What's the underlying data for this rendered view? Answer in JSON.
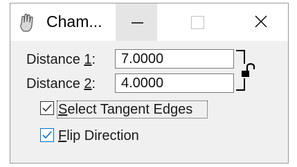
{
  "window": {
    "title": "Cham..."
  },
  "titlebar": {
    "app_icon": "hand-pointer-icon",
    "minimize_icon": "minimize-icon",
    "maximize_icon": "maximize-icon",
    "close_icon": "close-icon"
  },
  "form": {
    "distance1": {
      "label_prefix": "Distance ",
      "label_mnemonic": "1",
      "label_suffix": ":",
      "value": "7.0000"
    },
    "distance2": {
      "label_prefix": "Distance ",
      "label_mnemonic": "2",
      "label_suffix": ":",
      "value": "4.0000"
    },
    "lock_icon": "padlock-open-icon",
    "select_tangent_edges": {
      "label_mnemonic": "S",
      "label_rest": "elect Tangent Edges",
      "checked": true
    },
    "flip_direction": {
      "label_mnemonic": "F",
      "label_rest": "lip Direction",
      "checked": true
    }
  },
  "colors": {
    "checkbox_blue": "#0a6fd6",
    "checkbox_dark": "#333333",
    "minimize_hover_bg": "#e5e5e5"
  }
}
